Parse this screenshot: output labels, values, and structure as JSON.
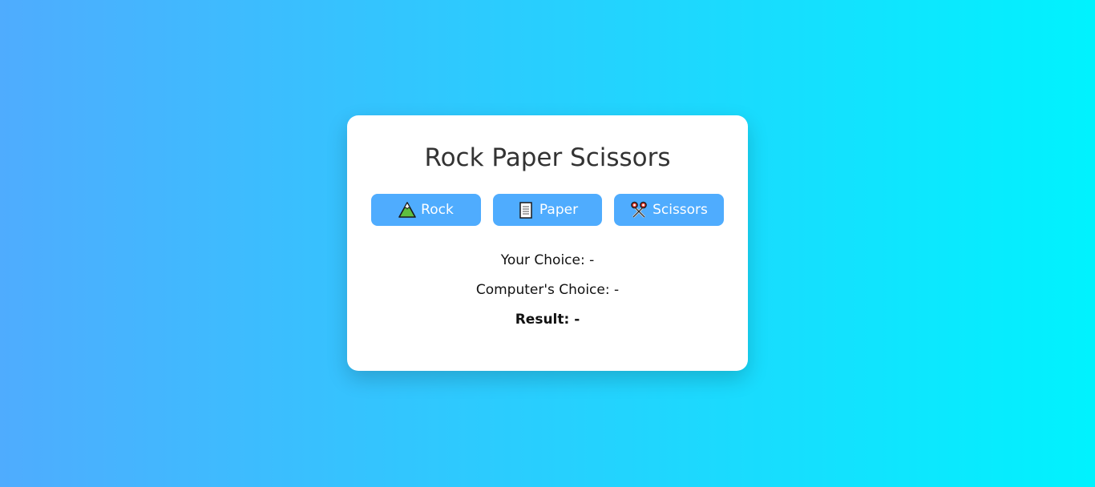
{
  "game": {
    "title": "Rock Paper Scissors",
    "buttons": {
      "rock": {
        "label": "Rock",
        "icon": "mountain-icon"
      },
      "paper": {
        "label": "Paper",
        "icon": "page-icon"
      },
      "scissors": {
        "label": "Scissors",
        "icon": "scissors-icon"
      }
    },
    "your_choice": "Your Choice: -",
    "computer_choice": "Computer's Choice: -",
    "result": "Result: -"
  },
  "colors": {
    "background_start": "#4facfe",
    "background_end": "#00f2fe",
    "button": "#4facfe",
    "card": "#ffffff"
  }
}
